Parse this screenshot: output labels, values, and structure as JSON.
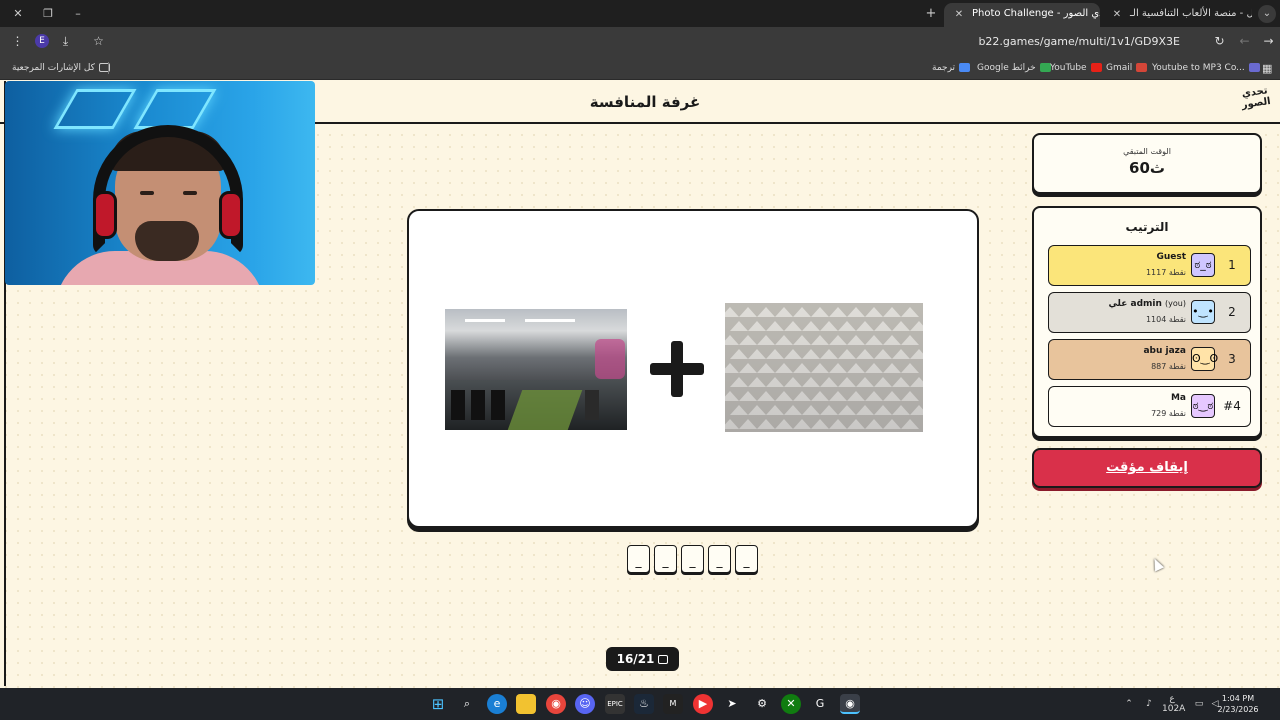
{
  "browser": {
    "tabs": [
      {
        "title": "نزال - منصة الألعاب التنافسية الـ",
        "active": false
      },
      {
        "title": "Photo Challenge - تحدي الصور",
        "active": true
      }
    ],
    "url": "b22.games/game/multi/1v1/GD9X3E",
    "bookmarks": {
      "all_label": "كل الإشارات المرجعية",
      "items": [
        "ترجمة",
        "Google خرائط",
        "YouTube",
        "Gmail",
        "Youtube to MP3 Co..."
      ]
    }
  },
  "page": {
    "room_title": "غرفة المنافسة",
    "logo_text": "تحدي الصور",
    "timer": {
      "label": "الوقت المتبقي",
      "value": "60ث"
    },
    "ranking": {
      "title": "الترتيب",
      "players": [
        {
          "rank": "1",
          "name": "Guest",
          "you": "",
          "points": "1117 نقطة",
          "color": "#fbe57a",
          "avatar": "ಠ_ಠ"
        },
        {
          "rank": "2",
          "name": "علي admin",
          "you": "(you)",
          "points": "1104 نقطة",
          "color": "#e3e0d8",
          "avatar": "•‿•"
        },
        {
          "rank": "3",
          "name": "abu jaza",
          "you": "",
          "points": "887 نقطة",
          "color": "#e8c49c",
          "avatar": "ʘ‿ʘ"
        },
        {
          "rank": "#4",
          "name": "Ma",
          "you": "",
          "points": "729 نقطة",
          "color": "#fffdf4",
          "avatar": "ಠ‿ಠ"
        }
      ]
    },
    "pause_button": "إيقاف مؤقت",
    "answer_slots": [
      "_",
      "_",
      "_",
      "_",
      "_"
    ],
    "progress": "16/21"
  },
  "taskbar": {
    "lang": "ع",
    "lang_sub": "102A",
    "time": "1:04 PM",
    "date": "2/23/2026"
  },
  "colors": {
    "page_bg": "#fdf6e3",
    "accent_red": "#d9304a",
    "first_place": "#fbe57a",
    "third_place": "#e8c49c"
  }
}
